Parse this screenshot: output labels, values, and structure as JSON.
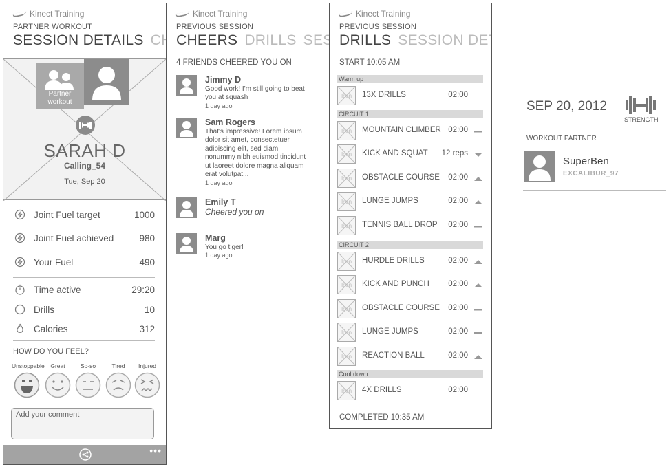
{
  "app": {
    "name": "Kinect Training"
  },
  "colors": {
    "placeholder": "#8c8c8c",
    "tile": "#a9a9a9",
    "appbar": "#a3a3a3",
    "divider": "#bbb"
  },
  "session": {
    "section": "PARTNER WORKOUT",
    "pivot": [
      "SESSION DETAILS",
      "CHEE"
    ],
    "partner_label": "Partner workout",
    "name": "SARAH D",
    "handle": "Calling_54",
    "date": "Tue, Sep 20",
    "stats": [
      {
        "icon": "fuel-icon",
        "label": "Joint Fuel target",
        "value": "1000"
      },
      {
        "icon": "fuel-icon",
        "label": "Joint Fuel achieved",
        "value": "980"
      },
      {
        "icon": "fuel-icon",
        "label": "Your Fuel",
        "value": "490"
      },
      {
        "icon": "stopwatch-icon",
        "label": "Time active",
        "value": "29:20"
      },
      {
        "icon": "circle-icon",
        "label": "Drills",
        "value": "10"
      },
      {
        "icon": "flame-icon",
        "label": "Calories",
        "value": "312"
      }
    ],
    "feel_title": "HOW DO YOU FEEL?",
    "moods": [
      "Unstoppable",
      "Great",
      "So-so",
      "Tired",
      "Injured"
    ],
    "comment_placeholder": "Add your comment"
  },
  "cheers": {
    "section": "PREVIOUS SESSION",
    "pivot": [
      "CHEERS",
      "DRILLS",
      "SESSI"
    ],
    "count_text": "4 FRIENDS CHEERED YOU ON",
    "items": [
      {
        "name": "Jimmy D",
        "message": "Good work! I'm still going to beat you at squash",
        "time": "1 day ago"
      },
      {
        "name": "Sam Rogers",
        "message": "That's impressive! Lorem ipsum dolor sit amet, consectetuer adipiscing elit, sed diam nonummy nibh euismod tincidunt ut laoreet dolore magna aliquam erat volutpat...",
        "time": "1 day ago"
      },
      {
        "name": "Emily T",
        "message": "Cheered you on",
        "time": ""
      },
      {
        "name": "Marg",
        "message": "You go tiger!",
        "time": "1 day ago"
      }
    ]
  },
  "drills": {
    "section": "PREVIOUS SESSION",
    "pivot": [
      "DRILLS",
      "SESSION DETA"
    ],
    "start": "START 10:05 AM",
    "completed": "COMPLETED 10:35 AM",
    "thumb_label": "Icon",
    "groups": [
      {
        "label": "Warm up",
        "items": [
          {
            "name": "13X DRILLS",
            "value": "02:00",
            "trend": "none"
          }
        ]
      },
      {
        "label": "CIRCUIT 1",
        "items": [
          {
            "name": "MOUNTAIN CLIMBER",
            "value": "02:00",
            "trend": "flat"
          },
          {
            "name": "KICK AND SQUAT",
            "value": "12 reps",
            "trend": "down"
          },
          {
            "name": "OBSTACLE COURSE",
            "value": "02:00",
            "trend": "up"
          },
          {
            "name": "LUNGE JUMPS",
            "value": "02:00",
            "trend": "up"
          },
          {
            "name": "TENNIS BALL DROP",
            "value": "02:00",
            "trend": "flat"
          }
        ]
      },
      {
        "label": "CIRCUIT 2",
        "items": [
          {
            "name": "HURDLE DRILLS",
            "value": "02:00",
            "trend": "up"
          },
          {
            "name": "KICK AND PUNCH",
            "value": "02:00",
            "trend": "up"
          },
          {
            "name": "OBSTACLE COURSE",
            "value": "02:00",
            "trend": "flat"
          },
          {
            "name": "LUNGE JUMPS",
            "value": "02:00",
            "trend": "flat"
          },
          {
            "name": "REACTION BALL",
            "value": "02:00",
            "trend": "up"
          }
        ]
      },
      {
        "label": "Cool down",
        "items": [
          {
            "name": "4X DRILLS",
            "value": "02:00",
            "trend": "none"
          }
        ]
      }
    ]
  },
  "card": {
    "date": "SEP 20, 2012",
    "category": "STRENGTH",
    "label": "WORKOUT PARTNER",
    "partner_name": "SuperBen",
    "partner_handle": "EXCALIBUR_97"
  }
}
